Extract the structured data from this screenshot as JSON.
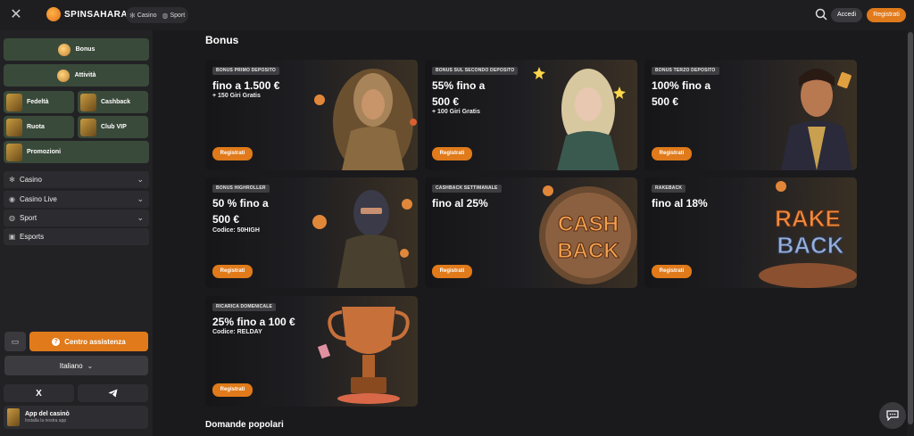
{
  "header": {
    "logo_text": "SPINSAHARA",
    "tabs": [
      {
        "label": "Casino",
        "icon": "casino-chip-icon"
      },
      {
        "label": "Sport",
        "icon": "ball-icon"
      }
    ],
    "login_label": "Accedi",
    "register_label": "Registrati"
  },
  "sidebar": {
    "promo_items": [
      {
        "label": "Bonus"
      },
      {
        "label": "Attività"
      },
      {
        "label": "Fedeltà"
      },
      {
        "label": "Cashback"
      },
      {
        "label": "Ruota"
      },
      {
        "label": "Club VIP"
      },
      {
        "label": "Promozioni"
      }
    ],
    "nav_items": [
      {
        "label": "Casino",
        "icon": "casino-chip-icon"
      },
      {
        "label": "Casino Live",
        "icon": "live-icon"
      },
      {
        "label": "Sport",
        "icon": "ball-icon"
      },
      {
        "label": "Esports",
        "icon": "gamepad-icon"
      }
    ],
    "help_label": "Centro assistenza",
    "language_label": "Italiano",
    "social": [
      "X",
      "Telegram"
    ],
    "app": {
      "title": "App del casinò",
      "subtitle": "Installa la nostra app"
    }
  },
  "main": {
    "title": "Bonus",
    "cards": [
      {
        "tag": "BONUS PRIMO DEPOSITO",
        "headline": "fino a 1.500 €",
        "sub": "+ 150 Giri Gratis",
        "cta": "Registrati"
      },
      {
        "tag": "BONUS SUL SECONDO DEPOSITO",
        "headline": "55% fino a\n500 €",
        "sub": "+ 100 Giri Gratis",
        "cta": "Registrati"
      },
      {
        "tag": "BONUS TERZO DEPOSITO",
        "headline": "100% fino a\n500 €",
        "sub": "",
        "cta": "Registrati"
      },
      {
        "tag": "BONUS HIGHROLLER",
        "headline": "50 % fino a\n 500 €",
        "sub": "Codice: 50HIGH",
        "cta": "Registrati"
      },
      {
        "tag": "CASHBACK SETTIMANALE",
        "headline": "fino al 25%",
        "sub": "",
        "cta": "Registrati",
        "art_text": [
          "CASH",
          "BACK"
        ]
      },
      {
        "tag": "RAKEBACK",
        "headline": "fino al 18%",
        "sub": "",
        "cta": "Registrati",
        "art_text": [
          "RAKE",
          "BACK"
        ]
      },
      {
        "tag": "RICARICA DOMENICALE",
        "headline": "25% fino a 100 €",
        "sub": "Codice: RELDAY",
        "cta": "Registrati"
      }
    ],
    "faq_title": "Domande popolari"
  },
  "colors": {
    "accent": "#e07a1a",
    "background": "#1a1a1c",
    "sidebar_item": "#3a4a3a"
  }
}
